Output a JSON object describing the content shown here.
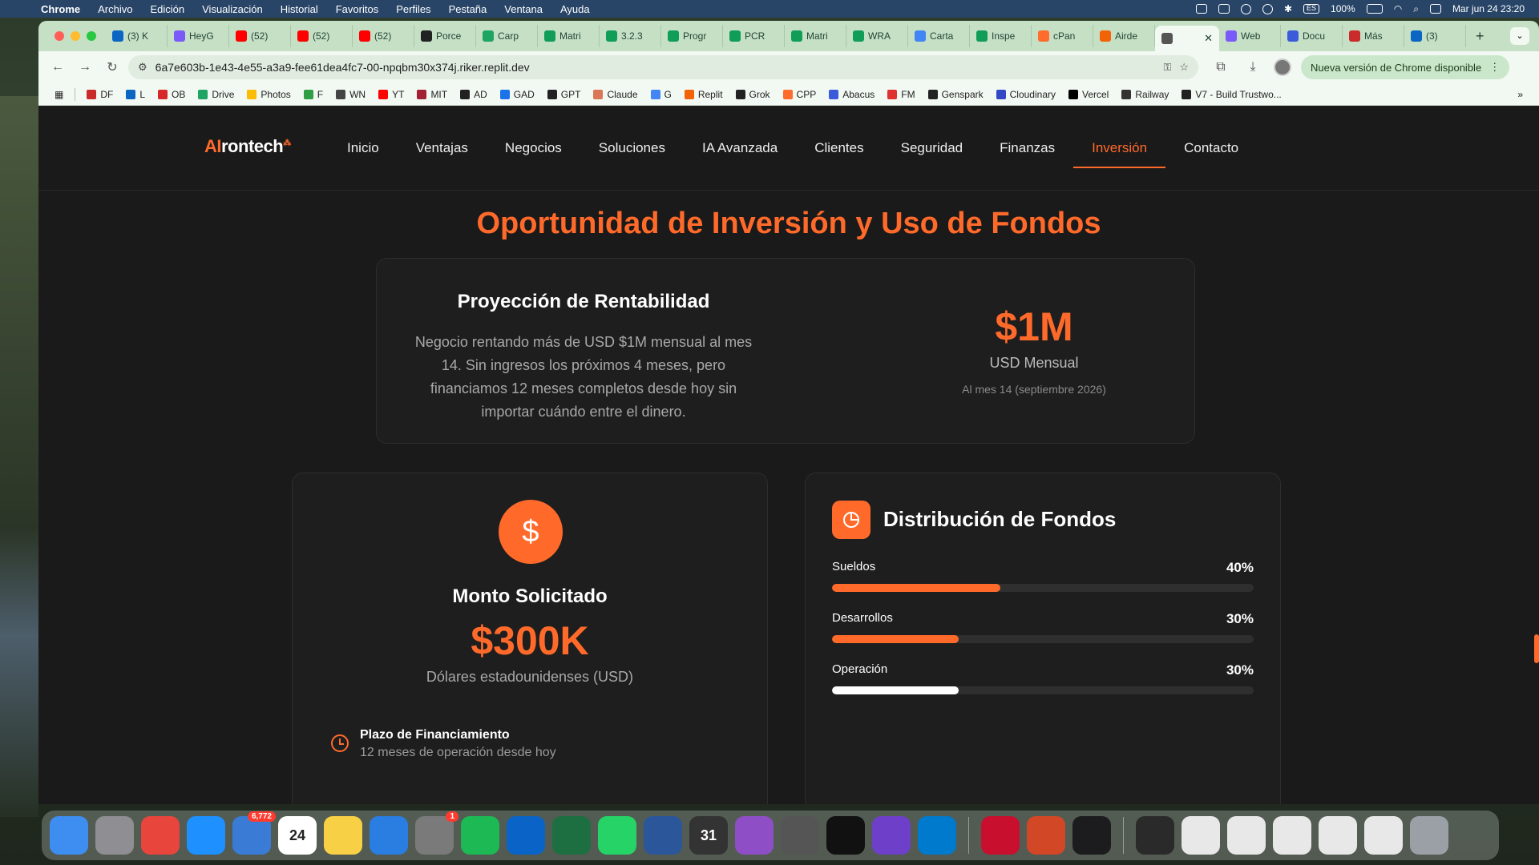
{
  "menubar": {
    "app": "Chrome",
    "items": [
      "Archivo",
      "Edición",
      "Visualización",
      "Historial",
      "Favoritos",
      "Perfiles",
      "Pestaña",
      "Ventana",
      "Ayuda"
    ],
    "battery": "100%",
    "input_source": "ES",
    "datetime": "Mar jun 24  23:20"
  },
  "tabs": [
    {
      "label": "(3) K",
      "color": "#0a66c2"
    },
    {
      "label": "HeyG",
      "color": "#7a5af8"
    },
    {
      "label": "(52)",
      "color": "#ff0000"
    },
    {
      "label": "(52)",
      "color": "#ff0000"
    },
    {
      "label": "(52)",
      "color": "#ff0000"
    },
    {
      "label": "Porce",
      "color": "#222222"
    },
    {
      "label": "Carp",
      "color": "#1fa463"
    },
    {
      "label": "Matri",
      "color": "#0f9d58"
    },
    {
      "label": "3.2.3",
      "color": "#0f9d58"
    },
    {
      "label": "Progr",
      "color": "#0f9d58"
    },
    {
      "label": "PCR",
      "color": "#0f9d58"
    },
    {
      "label": "Matri",
      "color": "#0f9d58"
    },
    {
      "label": "WRA",
      "color": "#0f9d58"
    },
    {
      "label": "Carta",
      "color": "#4285f4"
    },
    {
      "label": "Inspe",
      "color": "#0f9d58"
    },
    {
      "label": "cPan",
      "color": "#ff6c2c"
    },
    {
      "label": "Airde",
      "color": "#f26207"
    },
    {
      "label": "",
      "color": "#555555",
      "active": true
    },
    {
      "label": "Web",
      "color": "#7a5af8"
    },
    {
      "label": "Docu",
      "color": "#3b5bdb"
    },
    {
      "label": "Más",
      "color": "#c92a2a"
    },
    {
      "label": "(3)",
      "color": "#0a66c2"
    }
  ],
  "toolbar": {
    "url": "6a7e603b-1e43-4e55-a3a9-fee61dea4fc7-00-npqbm30x374j.riker.replit.dev",
    "update_label": "Nueva versión de Chrome disponible"
  },
  "bookmarks": [
    {
      "label": "DF",
      "color": "#c92a2a"
    },
    {
      "label": "L",
      "color": "#0a66c2"
    },
    {
      "label": "OB",
      "color": "#d62828"
    },
    {
      "label": "Drive",
      "color": "#1fa463"
    },
    {
      "label": "Photos",
      "color": "#fbbc04"
    },
    {
      "label": "F",
      "color": "#2f9e44"
    },
    {
      "label": "WN",
      "color": "#444444"
    },
    {
      "label": "YT",
      "color": "#ff0000"
    },
    {
      "label": "MIT",
      "color": "#a31f34"
    },
    {
      "label": "AD",
      "color": "#222222"
    },
    {
      "label": "GAD",
      "color": "#1a73e8"
    },
    {
      "label": "GPT",
      "color": "#222222"
    },
    {
      "label": "Claude",
      "color": "#d97757"
    },
    {
      "label": "G",
      "color": "#4285f4"
    },
    {
      "label": "Replit",
      "color": "#f26207"
    },
    {
      "label": "Grok",
      "color": "#222222"
    },
    {
      "label": "CPP",
      "color": "#ff6c2c"
    },
    {
      "label": "Abacus",
      "color": "#3b5bdb"
    },
    {
      "label": "FM",
      "color": "#e03131"
    },
    {
      "label": "Genspark",
      "color": "#222222"
    },
    {
      "label": "Cloudinary",
      "color": "#3448c5"
    },
    {
      "label": "Vercel",
      "color": "#000000"
    },
    {
      "label": "Railway",
      "color": "#333333"
    },
    {
      "label": "V7 - Build Trustwo...",
      "color": "#222222"
    }
  ],
  "site": {
    "logo_ai": "AI",
    "logo_rest": "rontech",
    "nav": [
      "Inicio",
      "Ventajas",
      "Negocios",
      "Soluciones",
      "IA Avanzada",
      "Clientes",
      "Seguridad",
      "Finanzas",
      "Inversión",
      "Contacto"
    ],
    "active_nav": "Inversión",
    "section_title": "Oportunidad de Inversión y Uso de Fondos",
    "projection": {
      "title": "Proyección de Rentabilidad",
      "text": "Negocio rentando más de USD $1M mensual al mes 14. Sin ingresos los próximos 4 meses, pero financiamos 12 meses completos desde hoy sin importar cuándo entre el dinero.",
      "big_value": "$1M",
      "big_label": "USD Mensual",
      "note": "Al mes 14 (septiembre 2026)"
    },
    "monto": {
      "icon": "$",
      "title": "Monto Solicitado",
      "value": "$300K",
      "subtitle": "Dólares estadounidenses (USD)",
      "plazo_title": "Plazo de Financiamiento",
      "plazo_sub": "12 meses de operación desde hoy"
    },
    "distribution": {
      "title": "Distribución de Fondos",
      "items": [
        {
          "label": "Sueldos",
          "pct_label": "40%",
          "fraction": 0.4,
          "color": "#ff6a2b"
        },
        {
          "label": "Desarrollos",
          "pct_label": "30%",
          "fraction": 0.3,
          "color": "#ff6a2b"
        },
        {
          "label": "Operación",
          "pct_label": "30%",
          "fraction": 0.3,
          "color": "#ffffff"
        }
      ]
    }
  },
  "dock": [
    {
      "name": "finder",
      "color": "#3d8ef0"
    },
    {
      "name": "launchpad",
      "color": "#8e8e93"
    },
    {
      "name": "chrome",
      "color": "#e8453c"
    },
    {
      "name": "safari",
      "color": "#1e90ff"
    },
    {
      "name": "mail",
      "color": "#3a7bd5",
      "badge": "6,772"
    },
    {
      "name": "calendar",
      "color": "#ffffff",
      "text": "24"
    },
    {
      "name": "notes",
      "color": "#f7d046"
    },
    {
      "name": "keynote",
      "color": "#2a7de1"
    },
    {
      "name": "system-settings",
      "color": "#7a7a7a",
      "badge": "1"
    },
    {
      "name": "spotify",
      "color": "#1db954"
    },
    {
      "name": "outlook",
      "color": "#0a64c8"
    },
    {
      "name": "excel",
      "color": "#1d6f42"
    },
    {
      "name": "whatsapp",
      "color": "#25d366"
    },
    {
      "name": "word",
      "color": "#2b579a"
    },
    {
      "name": "calendar-31",
      "color": "#333333",
      "text": "31"
    },
    {
      "name": "orbit-app",
      "color": "#8e4ec6"
    },
    {
      "name": "iphone-mirroring",
      "color": "#555555"
    },
    {
      "name": "retool",
      "color": "#111111"
    },
    {
      "name": "github-desktop",
      "color": "#6e40c9"
    },
    {
      "name": "vscode",
      "color": "#007acc"
    },
    {
      "name": "acrobat",
      "color": "#c8102e"
    },
    {
      "name": "powerpoint",
      "color": "#d24726"
    },
    {
      "name": "quicktime",
      "color": "#1c1c1e"
    },
    {
      "name": "window-1",
      "color": "#2a2a2a"
    },
    {
      "name": "window-2",
      "color": "#e8e8e8"
    },
    {
      "name": "window-3",
      "color": "#e8e8e8"
    },
    {
      "name": "window-4",
      "color": "#e8e8e8"
    },
    {
      "name": "window-5",
      "color": "#e8e8e8"
    },
    {
      "name": "window-6",
      "color": "#e8e8e8"
    },
    {
      "name": "trash",
      "color": "#9aa0a6"
    }
  ]
}
